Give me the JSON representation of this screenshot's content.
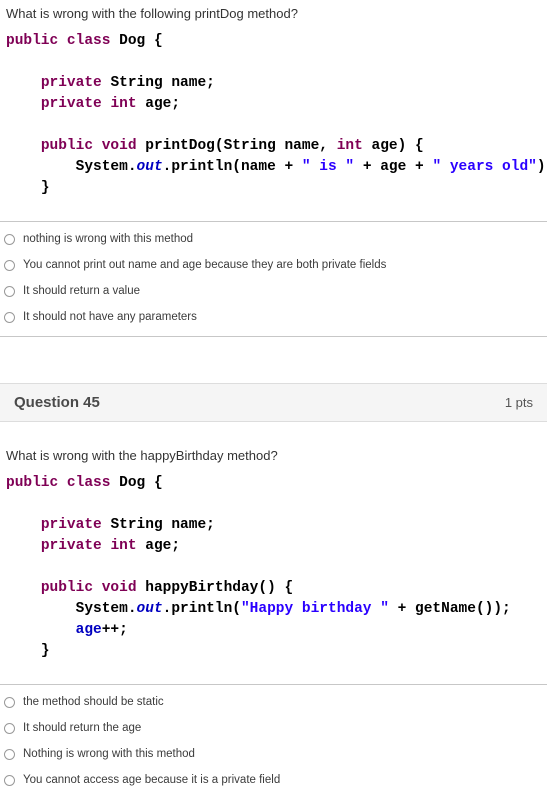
{
  "q44": {
    "prompt": "What is wrong with the following printDog method?",
    "code": {
      "l1a": "public",
      "l1b": "class",
      "l1c": "Dog {",
      "l2a": "private",
      "l2b": "String name;",
      "l3a": "private",
      "l3b": "int",
      "l3c": "age;",
      "l4a": "public",
      "l4b": "void",
      "l4c": "printDog(String name,",
      "l4d": "int",
      "l4e": "age) {",
      "l5a": "System.",
      "l5b": "out",
      "l5c": ".println(name +",
      "l5d": "\" is \"",
      "l5e": "+ age +",
      "l5f": "\" years old\"",
      "l5g": ");",
      "l6": "}"
    },
    "options": [
      "nothing is wrong with this method",
      "You cannot print out name and age because they are both private fields",
      "It should return a value",
      "It should not have any parameters"
    ]
  },
  "q45": {
    "header_title": "Question 45",
    "header_pts": "1 pts",
    "prompt": "What is wrong with the happyBirthday method?",
    "code": {
      "l1a": "public",
      "l1b": "class",
      "l1c": "Dog {",
      "l2a": "private",
      "l2b": "String name;",
      "l3a": "private",
      "l3b": "int",
      "l3c": "age;",
      "l4a": "public",
      "l4b": "void",
      "l4c": "happyBirthday() {",
      "l5a": "System.",
      "l5b": "out",
      "l5c": ".println(",
      "l5d": "\"Happy birthday \"",
      "l5e": "+ getName());",
      "l6a": "age",
      "l6b": "++;",
      "l7": "}"
    },
    "options": [
      "the method should be static",
      "It should return the age",
      "Nothing is wrong with this method",
      "You cannot access age because it is a private field"
    ]
  }
}
